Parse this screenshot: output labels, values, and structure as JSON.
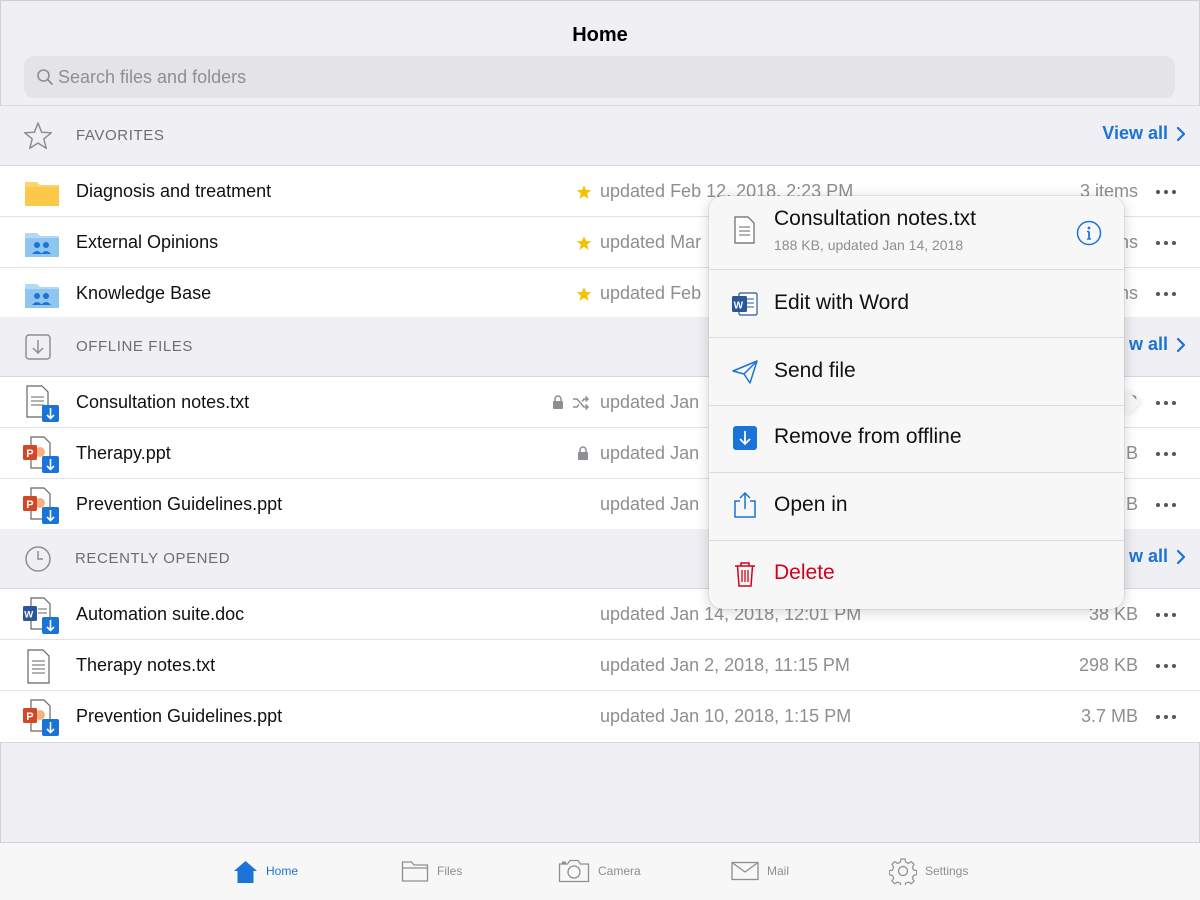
{
  "header": {
    "title": "Home",
    "search_placeholder": "Search files and folders"
  },
  "sections": {
    "favorites": {
      "title": "FAVORITES",
      "view_all": "View all",
      "rows": [
        {
          "name": "Diagnosis and treatment",
          "meta": "updated Feb 12, 2018, 2:23 PM",
          "size": "3 items"
        },
        {
          "name": "External Opinions",
          "meta": "updated Mar",
          "size": "ns"
        },
        {
          "name": "Knowledge Base",
          "meta": "updated Feb",
          "size": "ns"
        }
      ]
    },
    "offline": {
      "title": "OFFLINE FILES",
      "view_all": "w all",
      "rows": [
        {
          "name": "Consultation notes.txt",
          "meta": "updated Jan",
          "size": "B"
        },
        {
          "name": "Therapy.ppt",
          "meta": "updated Jan",
          "size": "B"
        },
        {
          "name": "Prevention Guidelines.ppt",
          "meta": "updated Jan",
          "size": "B"
        }
      ]
    },
    "recent": {
      "title": "RECENTLY OPENED",
      "view_all": "w all",
      "rows": [
        {
          "name": "Automation suite.doc",
          "meta": "updated Jan 14, 2018, 12:01 PM",
          "size": "38 KB"
        },
        {
          "name": "Therapy notes.txt",
          "meta": "updated Jan 2, 2018, 11:15 PM",
          "size": "298 KB"
        },
        {
          "name": "Prevention Guidelines.ppt",
          "meta": "updated Jan 10, 2018, 1:15 PM",
          "size": "3.7 MB"
        }
      ]
    }
  },
  "popover": {
    "file_name": "Consultation notes.txt",
    "file_info": "188 KB, updated Jan 14, 2018",
    "actions": {
      "edit": "Edit with Word",
      "send": "Send file",
      "remove": "Remove from offline",
      "open": "Open in",
      "delete": "Delete"
    }
  },
  "tabbar": {
    "home": "Home",
    "files": "Files",
    "camera": "Camera",
    "mail": "Mail",
    "settings": "Settings"
  },
  "colors": {
    "accent": "#1a73d9",
    "delete": "#d0021b",
    "star": "#f2c200",
    "folder": "#fcd56a",
    "shared_folder": "#8fc6ef",
    "ppt": "#d24726",
    "word": "#2b579a"
  }
}
